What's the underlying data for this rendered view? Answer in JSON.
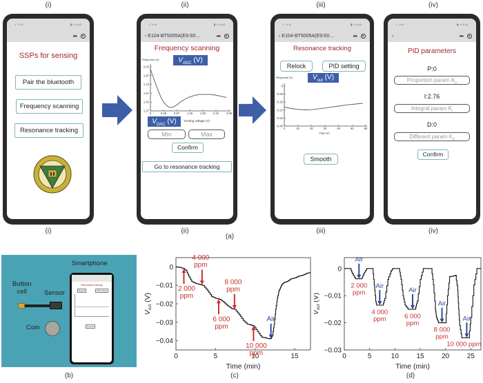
{
  "panel_labels": {
    "top_i": "(i)",
    "top_ii": "(ii)",
    "top_iii": "(iii)",
    "top_iv": "(iv)",
    "bot_i": "(i)",
    "bot_ii": "(ii)",
    "bot_iii": "(iii)",
    "bot_iv": "(iv)",
    "a": "(a)",
    "b": "(b)",
    "c": "(c)",
    "d": "(d)"
  },
  "colors": {
    "title_red": "#a3262a",
    "accent_blue": "#3e5fa8",
    "button_border": "#7fb4b9",
    "photo_bg": "#4aa3b5",
    "annotation_red": "#c9302c",
    "annotation_blue": "#2e4b9a"
  },
  "status_bar": {
    "left": "▪ ᐩ.ıl ≋",
    "right": "▮ ▭ 4:43"
  },
  "screen1": {
    "title": "SSPs for sensing",
    "buttons": [
      "Pair the bluetooth",
      "Frequency scanning",
      "Resonance tracking"
    ],
    "logo": "southeast-university-emblem"
  },
  "screen2": {
    "nav_title": "E104-BT5005A(E9:93:...",
    "title": "Frequency scanning",
    "y_label_button": "V_ADC (V)",
    "y_label_main": "V",
    "y_label_sub": "ADC",
    "y_label_unit": " (V)",
    "x_label_main": "V",
    "x_label_sub": "DAC",
    "x_label_unit": " (V)",
    "axis_y_title": "Response (V)",
    "axis_x_title": "Turning voltage (V)",
    "y_ticks": [
      "2.02",
      "1.87",
      "1.72",
      "1.57",
      "1.42",
      "1.27"
    ],
    "x_ticks": [
      "0",
      "0.48",
      "0.97",
      "1.45",
      "1.93",
      "2.42",
      "2.90"
    ],
    "min_placeholder": "Min",
    "max_placeholder": "Max",
    "confirm": "Confirm",
    "go_button": "Go to resonance tracking"
  },
  "screen3": {
    "nav_title": "E104-BT5005A(E9:93:...",
    "title": "Resonance tracking",
    "relock": "Relock",
    "pid_setting": "PID setting",
    "y_label_main": "V",
    "y_label_sub": "out",
    "y_label_unit": " (V)",
    "axis_y_title": "Response (V)",
    "axis_x_title": "Time (s)",
    "y_ticks": [
      "0",
      "-0.08",
      "-0.16",
      "-0.24",
      "-0.32",
      "-0.40"
    ],
    "x_ticks": [
      "0",
      "10",
      "20",
      "30",
      "40",
      "50",
      "60"
    ],
    "smooth": "Smooth"
  },
  "screen4": {
    "title": "PID parameters",
    "p_value": "P:0",
    "p_placeholder": "Proportion param K",
    "p_sub": "p",
    "i_value": "I:2.76",
    "i_placeholder": "Integral param K",
    "i_sub": "i",
    "d_value": "D:0",
    "d_placeholder": "Different param K",
    "d_sub": "d",
    "confirm": "Confirm"
  },
  "photo_b": {
    "labels": {
      "smartphone": "Smartphone",
      "button_cell": "Button\ncell",
      "sensor": "Sensor",
      "coin": "Coin"
    },
    "phone_title": "Resonance tracking",
    "phone_relock": "Relock",
    "phone_pid": "PID setting",
    "phone_smooth": "Smooth"
  },
  "chart_data": [
    {
      "id": "screen2-frequency-scan",
      "type": "line",
      "xlabel": "Turning voltage (V)",
      "ylabel": "Response (V)",
      "xlim": [
        0,
        2.9
      ],
      "ylim": [
        1.27,
        2.02
      ],
      "x": [
        0,
        0.1,
        0.2,
        0.3,
        0.4,
        0.5,
        0.6,
        0.7,
        0.8,
        0.9,
        1.0,
        1.1,
        1.2,
        1.4,
        1.6,
        1.8,
        2.0,
        2.2,
        2.4,
        2.6,
        2.8
      ],
      "y": [
        1.98,
        1.85,
        1.72,
        1.6,
        1.49,
        1.41,
        1.36,
        1.33,
        1.33,
        1.35,
        1.38,
        1.42,
        1.45,
        1.5,
        1.53,
        1.55,
        1.55,
        1.55,
        1.54,
        1.52,
        1.5
      ]
    },
    {
      "id": "screen3-resonance-track",
      "type": "line",
      "xlabel": "Time (s)",
      "ylabel": "Response (V)",
      "xlim": [
        0,
        60
      ],
      "ylim": [
        -0.4,
        0.02
      ],
      "x": [
        0,
        5,
        10,
        15,
        20,
        25,
        30,
        35,
        40,
        45,
        50,
        55,
        58
      ],
      "y": [
        -0.2,
        -0.215,
        -0.225,
        -0.23,
        -0.228,
        -0.22,
        -0.21,
        -0.2,
        -0.19,
        -0.18,
        -0.172,
        -0.165,
        -0.16
      ]
    },
    {
      "id": "panel-c",
      "type": "line",
      "xlabel": "Time (min)",
      "ylabel": "V_out (V)",
      "xlim": [
        0,
        17
      ],
      "ylim": [
        -0.045,
        0.005
      ],
      "x_ticks": [
        0,
        5,
        10,
        15
      ],
      "y_ticks": [
        0,
        -0.01,
        -0.02,
        -0.03,
        -0.04
      ],
      "y_tick_labels": [
        "0",
        "−0.01",
        "−0.02",
        "−0.03",
        "−0.04"
      ],
      "x": [
        0,
        0.5,
        1.0,
        1.3,
        1.6,
        2.0,
        2.5,
        3.0,
        3.4,
        4.0,
        4.5,
        5.0,
        5.5,
        6.0,
        6.5,
        7.0,
        7.4,
        8.0,
        8.5,
        9.0,
        9.5,
        9.8,
        10.3,
        10.8,
        11.3,
        11.8,
        12.0,
        12.2,
        12.4,
        12.6,
        12.8,
        13.0,
        13.3,
        13.6,
        14.0,
        14.5,
        15.0,
        15.5,
        16.0,
        16.5,
        17.0
      ],
      "y": [
        0,
        -0.0003,
        -0.001,
        -0.002,
        -0.005,
        -0.008,
        -0.009,
        -0.0095,
        -0.01,
        -0.013,
        -0.016,
        -0.017,
        -0.0175,
        -0.019,
        -0.021,
        -0.0225,
        -0.023,
        -0.026,
        -0.029,
        -0.031,
        -0.0315,
        -0.032,
        -0.035,
        -0.038,
        -0.0385,
        -0.039,
        -0.0388,
        -0.037,
        -0.031,
        -0.023,
        -0.017,
        -0.013,
        -0.01,
        -0.0085,
        -0.008,
        -0.0065,
        -0.006,
        -0.005,
        -0.0045,
        -0.0035,
        -0.003
      ],
      "annotations": [
        {
          "text": "2 000\nppm",
          "x": 1.0,
          "y": -0.001,
          "color": "red",
          "direction": "up"
        },
        {
          "text": "4 000\nppm",
          "x": 3.3,
          "y": -0.0097,
          "color": "red",
          "direction": "down"
        },
        {
          "text": "6 000\nppm",
          "x": 5.4,
          "y": -0.0175,
          "color": "red",
          "direction": "up"
        },
        {
          "text": "8 000\nppm",
          "x": 7.4,
          "y": -0.023,
          "color": "red",
          "direction": "down"
        },
        {
          "text": "10 000\nppm",
          "x": 9.8,
          "y": -0.032,
          "color": "red",
          "direction": "up"
        },
        {
          "text": "Air",
          "x": 12.0,
          "y": -0.039,
          "color": "blue",
          "direction": "down"
        }
      ]
    },
    {
      "id": "panel-d",
      "type": "line",
      "xlabel": "Time (min)",
      "ylabel": "V_out (V)",
      "xlim": [
        0,
        27
      ],
      "ylim": [
        -0.03,
        0.004
      ],
      "x_ticks": [
        0,
        5,
        10,
        15,
        20,
        25
      ],
      "y_ticks": [
        0,
        -0.01,
        -0.02,
        -0.03
      ],
      "y_tick_labels": [
        "0",
        "−0.01",
        "−0.02",
        "−0.03"
      ],
      "x": [
        0,
        1.2,
        1.6,
        2.2,
        3.4,
        3.8,
        4.4,
        5.6,
        5.9,
        6.2,
        6.4,
        7.6,
        8.0,
        8.6,
        9.2,
        9.6,
        10.8,
        11.2,
        11.6,
        12.0,
        12.6,
        14.0,
        14.4,
        15.0,
        15.6,
        16.2,
        17.2,
        17.6,
        18.0,
        18.2,
        18.6,
        20.0,
        20.4,
        20.8,
        22.0,
        22.4,
        22.6,
        22.8,
        23.2,
        24.6,
        25.0,
        25.6,
        26.2,
        27.0
      ],
      "y": [
        0,
        0,
        -0.002,
        -0.0038,
        -0.0038,
        -0.002,
        0,
        0,
        -0.006,
        -0.012,
        -0.0135,
        -0.0135,
        -0.011,
        -0.004,
        -0.001,
        0,
        0,
        -0.004,
        -0.01,
        -0.0135,
        -0.015,
        -0.015,
        -0.012,
        -0.004,
        0,
        0,
        0,
        -0.006,
        -0.015,
        -0.018,
        -0.02,
        -0.02,
        -0.01,
        -0.003,
        -0.0025,
        -0.008,
        -0.015,
        -0.021,
        -0.0255,
        -0.0255,
        -0.018,
        -0.006,
        0,
        0
      ],
      "annotations": [
        {
          "text": "Air",
          "x": 2.9,
          "y": -0.0038,
          "color": "blue",
          "direction": "down",
          "ppm": "2 000\nppm"
        },
        {
          "text": "Air",
          "x": 7.0,
          "y": -0.0135,
          "color": "blue",
          "direction": "down",
          "ppm": "4 000\nppm"
        },
        {
          "text": "Air",
          "x": 13.5,
          "y": -0.015,
          "color": "blue",
          "direction": "down",
          "ppm": "6 000\nppm"
        },
        {
          "text": "Air",
          "x": 19.3,
          "y": -0.02,
          "color": "blue",
          "direction": "down",
          "ppm": "8 000\nppm"
        },
        {
          "text": "Air",
          "x": 24.2,
          "y": -0.0255,
          "color": "blue",
          "direction": "down",
          "ppm": "10 000 ppm"
        }
      ]
    }
  ]
}
